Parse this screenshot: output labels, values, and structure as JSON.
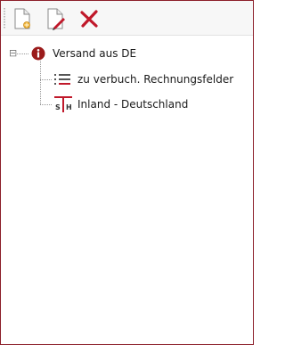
{
  "toolbar": {
    "buttons": [
      {
        "icon": "new-document-icon"
      },
      {
        "icon": "edit-document-icon"
      },
      {
        "icon": "delete-icon",
        "color": "#c0182a"
      }
    ]
  },
  "tree": {
    "root": {
      "label": "Versand aus DE",
      "icon": "info-icon",
      "expander": "⊟",
      "children": [
        {
          "label": "zu verbuch. Rechnungsfelder",
          "icon": "list-icon"
        },
        {
          "label": "Inland - Deutschland",
          "icon": "tax-code-icon",
          "icon_text": [
            "S",
            "H"
          ]
        }
      ]
    }
  },
  "colors": {
    "frame_border": "#8c1f2a",
    "accent_red": "#c0182a",
    "info_icon": "#9b1b1b"
  }
}
